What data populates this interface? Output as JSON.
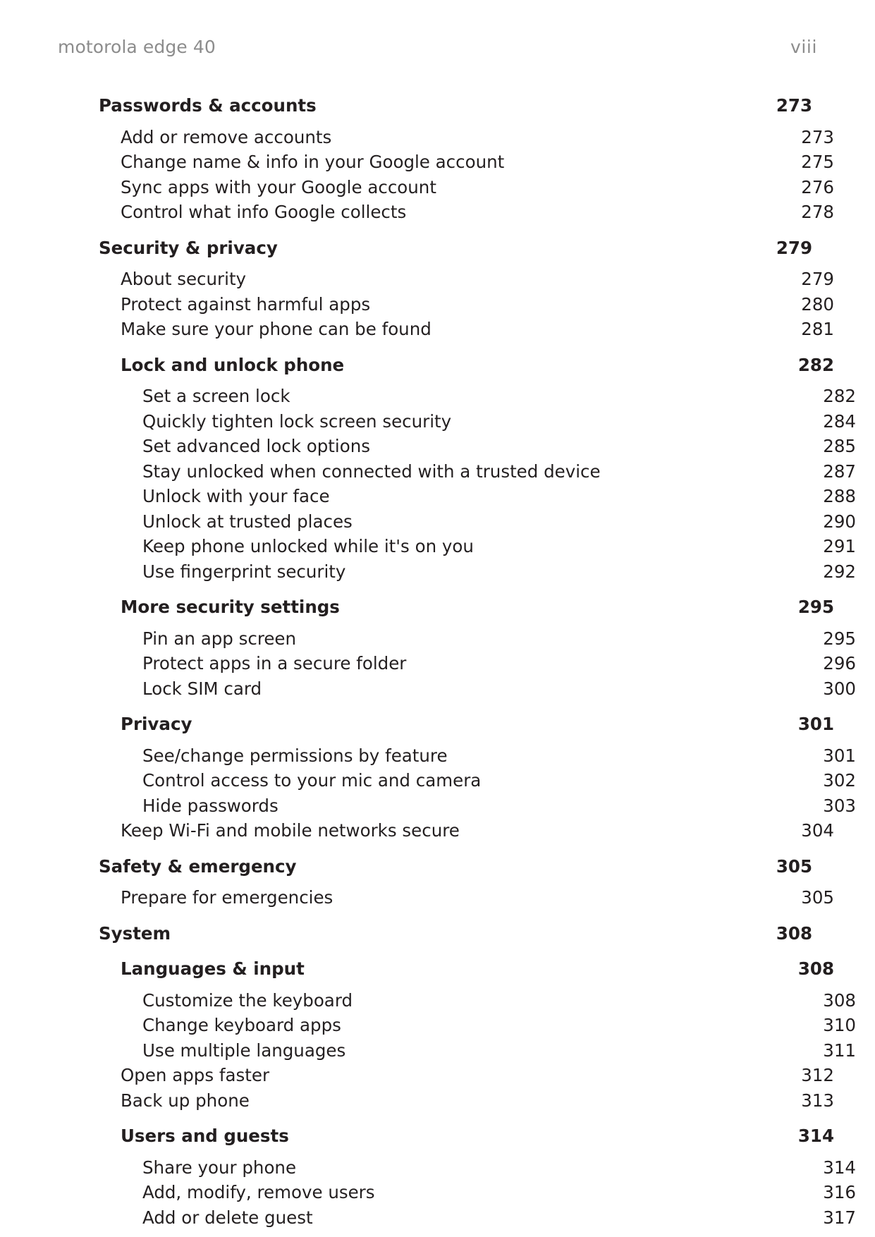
{
  "header": {
    "device_title": "motorola edge 40",
    "folio": "viii"
  },
  "toc": {
    "entries": [
      {
        "level": 1,
        "label": "Passwords & accounts",
        "page": "273",
        "bold": true
      },
      {
        "level": 2,
        "label": "Add or remove accounts",
        "page": "273",
        "bold": false
      },
      {
        "level": 2,
        "label": "Change name & info in your Google account",
        "page": "275",
        "bold": false
      },
      {
        "level": 2,
        "label": "Sync apps with your Google account",
        "page": "276",
        "bold": false
      },
      {
        "level": 2,
        "label": "Control what info Google collects",
        "page": "278",
        "bold": false
      },
      {
        "level": 1,
        "label": "Security & privacy",
        "page": "279",
        "bold": true
      },
      {
        "level": 2,
        "label": "About security",
        "page": "279",
        "bold": false
      },
      {
        "level": 2,
        "label": "Protect against harmful apps",
        "page": "280",
        "bold": false
      },
      {
        "level": 2,
        "label": "Make sure your phone can be found",
        "page": "281",
        "bold": false
      },
      {
        "level": 2,
        "label": "Lock and unlock phone",
        "page": "282",
        "bold": true
      },
      {
        "level": 3,
        "label": "Set a screen lock",
        "page": "282",
        "bold": false
      },
      {
        "level": 3,
        "label": "Quickly tighten lock screen security",
        "page": "284",
        "bold": false
      },
      {
        "level": 3,
        "label": "Set advanced lock options",
        "page": "285",
        "bold": false
      },
      {
        "level": 3,
        "label": "Stay unlocked when connected with a trusted device",
        "page": "287",
        "bold": false
      },
      {
        "level": 3,
        "label": "Unlock with your face",
        "page": "288",
        "bold": false
      },
      {
        "level": 3,
        "label": "Unlock at trusted places",
        "page": "290",
        "bold": false
      },
      {
        "level": 3,
        "label": "Keep phone unlocked while it's on you",
        "page": "291",
        "bold": false
      },
      {
        "level": 3,
        "label": "Use fingerprint security",
        "page": "292",
        "bold": false
      },
      {
        "level": 2,
        "label": "More security settings",
        "page": "295",
        "bold": true
      },
      {
        "level": 3,
        "label": "Pin an app screen",
        "page": "295",
        "bold": false
      },
      {
        "level": 3,
        "label": "Protect apps in a secure folder",
        "page": "296",
        "bold": false
      },
      {
        "level": 3,
        "label": "Lock SIM card",
        "page": "300",
        "bold": false
      },
      {
        "level": 2,
        "label": "Privacy",
        "page": "301",
        "bold": true
      },
      {
        "level": 3,
        "label": "See/change permissions by feature",
        "page": "301",
        "bold": false
      },
      {
        "level": 3,
        "label": "Control access to your mic and camera",
        "page": "302",
        "bold": false
      },
      {
        "level": 3,
        "label": "Hide passwords",
        "page": "303",
        "bold": false
      },
      {
        "level": 2,
        "label": "Keep Wi-Fi and mobile networks secure",
        "page": "304",
        "bold": false
      },
      {
        "level": 1,
        "label": "Safety & emergency",
        "page": "305",
        "bold": true
      },
      {
        "level": 2,
        "label": "Prepare for emergencies",
        "page": "305",
        "bold": false
      },
      {
        "level": 1,
        "label": "System",
        "page": "308",
        "bold": true
      },
      {
        "level": 2,
        "label": "Languages & input",
        "page": "308",
        "bold": true
      },
      {
        "level": 3,
        "label": "Customize the keyboard",
        "page": "308",
        "bold": false
      },
      {
        "level": 3,
        "label": "Change keyboard apps",
        "page": "310",
        "bold": false
      },
      {
        "level": 3,
        "label": "Use multiple languages",
        "page": "311",
        "bold": false
      },
      {
        "level": 2,
        "label": "Open apps faster",
        "page": "312",
        "bold": false
      },
      {
        "level": 2,
        "label": "Back up phone",
        "page": "313",
        "bold": false
      },
      {
        "level": 2,
        "label": "Users and guests",
        "page": "314",
        "bold": true
      },
      {
        "level": 3,
        "label": "Share your phone",
        "page": "314",
        "bold": false
      },
      {
        "level": 3,
        "label": "Add, modify, remove users",
        "page": "316",
        "bold": false
      },
      {
        "level": 3,
        "label": "Add or delete guest",
        "page": "317",
        "bold": false
      }
    ]
  },
  "colors": {
    "text": "#231f20",
    "header_text": "#8c8c8c",
    "background": "#ffffff"
  }
}
